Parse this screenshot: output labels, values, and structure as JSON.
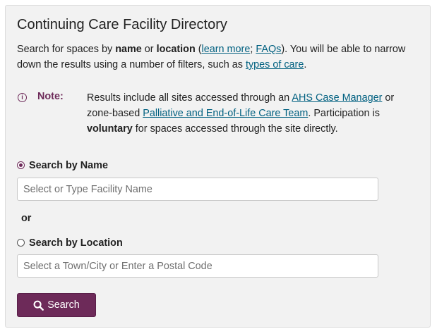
{
  "title": "Continuing Care Facility Directory",
  "intro": {
    "t1": "Search for spaces by ",
    "b1": "name",
    "t2": " or ",
    "b2": "location",
    "t3": " (",
    "link_learn_more": "learn more",
    "t4": "; ",
    "link_faqs": "FAQs",
    "t5": "). You will be able to narrow down the results using a number of filters, such as ",
    "link_types_of_care": "types of care",
    "t6": "."
  },
  "note": {
    "icon": "info-icon",
    "icon_glyph": "i",
    "label": "Note:",
    "t1": "Results include all sites accessed through an ",
    "link_case_manager": "AHS Case Manager",
    "t2": " or zone-based ",
    "link_palliative": "Palliative and End-of-Life Care Team",
    "t3": ". Participation is ",
    "b1": "voluntary",
    "t4": " for spaces accessed through the site directly."
  },
  "search_by_name": {
    "label": "Search by Name",
    "selected": true,
    "placeholder": "Select or Type Facility Name",
    "value": ""
  },
  "or_label": "or",
  "search_by_location": {
    "label": "Search by Location",
    "selected": false,
    "placeholder": "Select a Town/City or Enter a Postal Code",
    "value": ""
  },
  "search_button": {
    "label": "Search",
    "icon": "search-icon"
  },
  "colors": {
    "accent": "#6d2a59",
    "link": "#006080",
    "panel_bg": "#f2f2f2"
  }
}
